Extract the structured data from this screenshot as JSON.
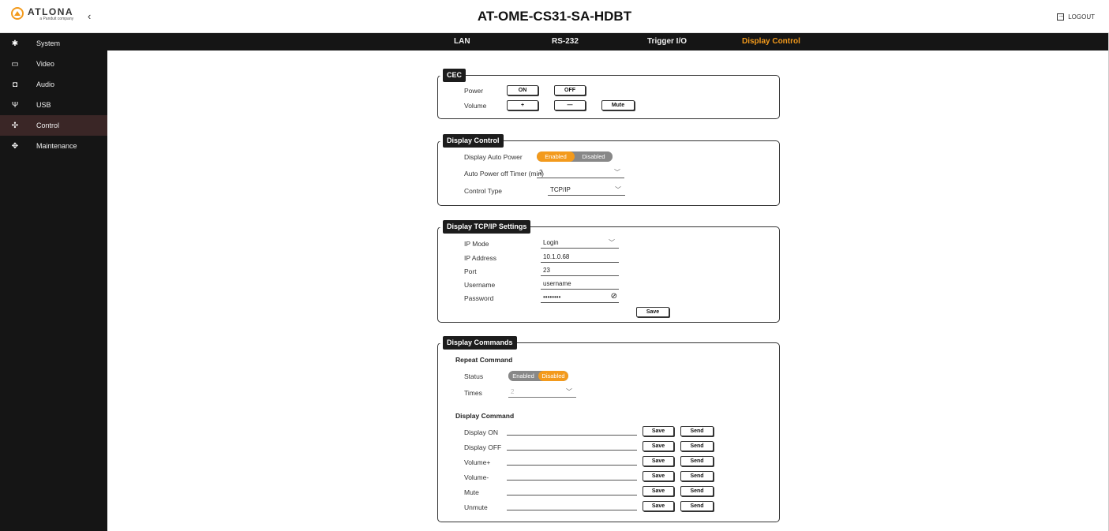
{
  "header": {
    "logo_text": "ATLONA",
    "logo_sub": "a Panduit company",
    "title": "AT-OME-CS31-SA-HDBT",
    "logout_label": "LOGOUT"
  },
  "sidebar": {
    "items": [
      {
        "label": "System",
        "icon": "gear-icon"
      },
      {
        "label": "Video",
        "icon": "monitor-icon"
      },
      {
        "label": "Audio",
        "icon": "speaker-icon"
      },
      {
        "label": "USB",
        "icon": "usb-icon"
      },
      {
        "label": "Control",
        "icon": "network-icon",
        "active": true
      },
      {
        "label": "Maintenance",
        "icon": "arrows-icon"
      }
    ]
  },
  "tabs": [
    {
      "label": "LAN"
    },
    {
      "label": "RS-232"
    },
    {
      "label": "Trigger I/O"
    },
    {
      "label": "Display Control",
      "active": true
    }
  ],
  "cec": {
    "title": "CEC",
    "power_label": "Power",
    "on_label": "ON",
    "off_label": "OFF",
    "volume_label": "Volume",
    "plus_label": "+",
    "minus_label": "—",
    "mute_label": "Mute"
  },
  "display_control": {
    "title": "Display Control",
    "auto_power_label": "Display Auto Power",
    "auto_power": {
      "enabled": "Enabled",
      "disabled": "Disabled",
      "selected": "Enabled"
    },
    "timer_label": "Auto Power off Timer (min)",
    "timer_value": "2",
    "control_type_label": "Control Type",
    "control_type_value": "TCP/IP"
  },
  "tcpip": {
    "title": "Display TCP/IP Settings",
    "ip_mode_label": "IP Mode",
    "ip_mode_value": "Login",
    "ip_address_label": "IP Address",
    "ip_address_value": "10.1.0.68",
    "port_label": "Port",
    "port_value": "23",
    "username_label": "Username",
    "username_value": "username",
    "password_label": "Password",
    "password_value": "••••••••",
    "save_label": "Save"
  },
  "commands": {
    "title": "Display Commands",
    "repeat_heading": "Repeat Command",
    "status_label": "Status",
    "status": {
      "enabled": "Enabled",
      "disabled": "Disabled",
      "selected": "Disabled"
    },
    "times_label": "Times",
    "times_value": "2",
    "command_heading": "Display Command",
    "save_label": "Save",
    "send_label": "Send",
    "rows": [
      {
        "label": "Display ON",
        "value": ""
      },
      {
        "label": "Display OFF",
        "value": ""
      },
      {
        "label": "Volume+",
        "value": ""
      },
      {
        "label": "Volume-",
        "value": ""
      },
      {
        "label": "Mute",
        "value": ""
      },
      {
        "label": "Unmute",
        "value": ""
      }
    ]
  },
  "colors": {
    "accent": "#f39a1c",
    "sidebar_bg": "#151515",
    "active_item_bg": "#3a2626"
  }
}
